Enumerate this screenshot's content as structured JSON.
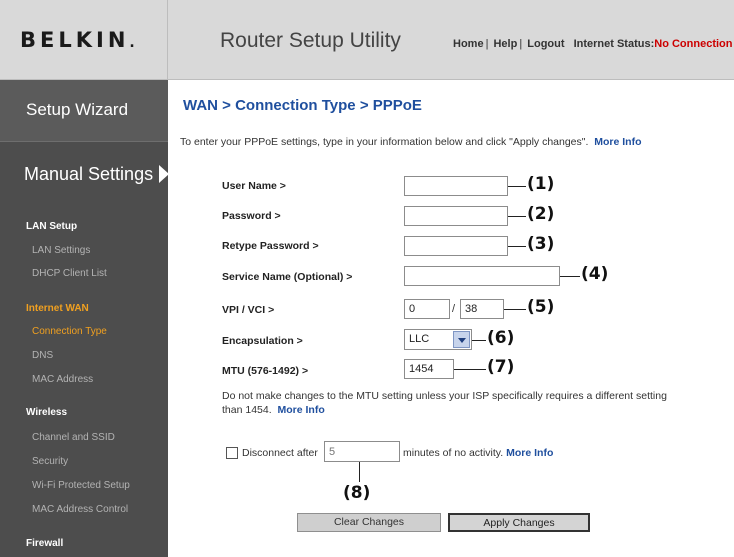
{
  "header": {
    "logo": "BELKIN",
    "logo_mark": ".",
    "title": "Router Setup Utility",
    "links": [
      "Home",
      "Help",
      "Logout"
    ],
    "status_label": "Internet Status:",
    "status_value": "No Connection",
    "status_color": "#cc0000"
  },
  "sidebar": {
    "setup_wizard": "Setup Wizard",
    "manual_settings": "Manual Settings",
    "sections": [
      {
        "title": "LAN Setup",
        "items": [
          "LAN Settings",
          "DHCP Client List"
        ]
      },
      {
        "title": "Internet WAN",
        "items": [
          "Connection Type",
          "DNS",
          "MAC Address"
        ]
      },
      {
        "title": "Wireless",
        "items": [
          "Channel and SSID",
          "Security",
          "Wi-Fi Protected Setup",
          "MAC Address Control"
        ]
      },
      {
        "title": "Firewall",
        "items": []
      }
    ],
    "active_color": "#f0a020"
  },
  "main": {
    "title": "WAN > Connection Type > PPPoE",
    "intro": "To enter your PPPoE settings, type in your information below and click \"Apply changes\".",
    "more_info": "More Info",
    "fields": {
      "user_name": {
        "label": "User Name >",
        "value": "",
        "callout": "(1)"
      },
      "password": {
        "label": "Password >",
        "value": "",
        "callout": "(2)"
      },
      "retype_password": {
        "label": "Retype Password >",
        "value": "",
        "callout": "(3)"
      },
      "service_name": {
        "label": "Service Name (Optional) >",
        "value": "",
        "callout": "(4)"
      },
      "vpi_vci": {
        "label": "VPI / VCI >",
        "vpi": "0",
        "slash": "/",
        "vci": "38",
        "callout": "(5)"
      },
      "encapsulation": {
        "label": "Encapsulation >",
        "value": "LLC",
        "callout": "(6)"
      },
      "mtu": {
        "label": "MTU (576-1492) >",
        "value": "1454",
        "callout": "(7)"
      }
    },
    "mtu_note": "Do not make changes to the MTU setting unless your ISP specifically requires a different setting than 1454.",
    "disconnect": {
      "label": "Disconnect after",
      "placeholder": "5",
      "suffix": "minutes of no activity.",
      "callout": "(8)"
    },
    "buttons": {
      "clear": "Clear Changes",
      "apply": "Apply Changes"
    },
    "title_color": "#1f4f9e"
  }
}
